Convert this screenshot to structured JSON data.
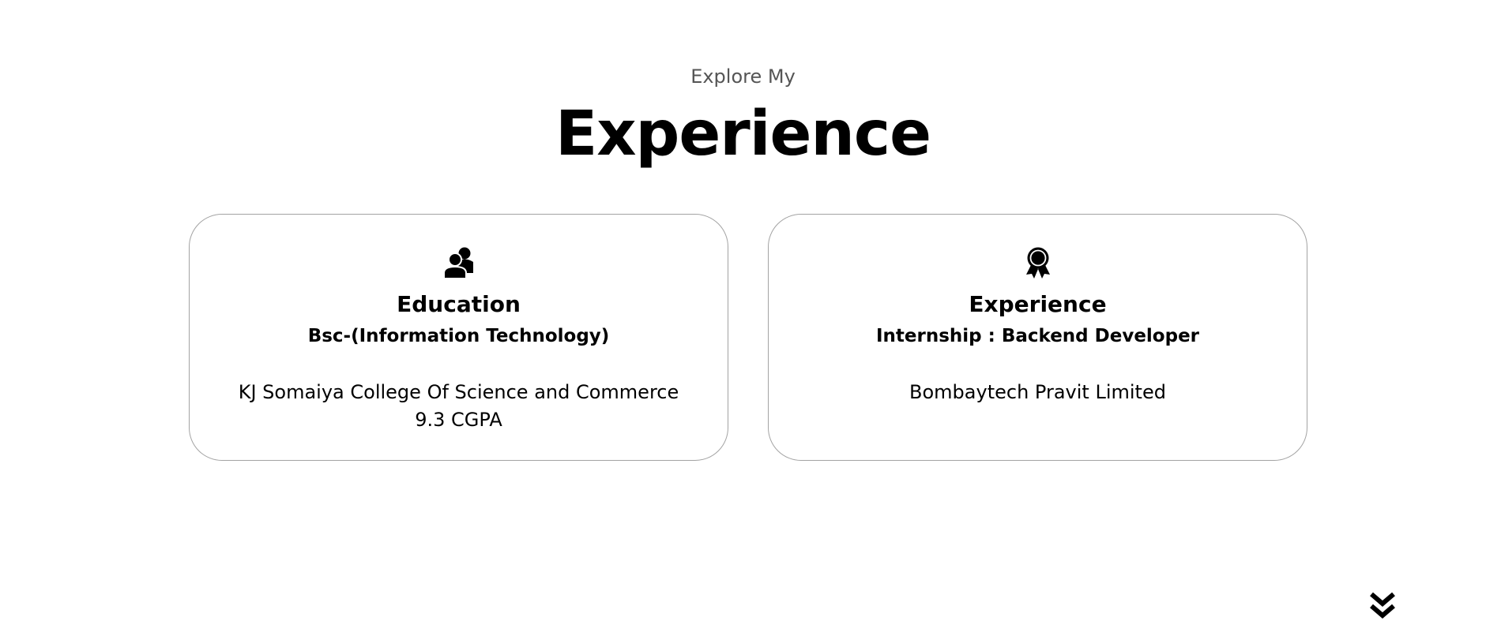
{
  "header": {
    "pre_title": "Explore My",
    "title": "Experience"
  },
  "cards": [
    {
      "icon": "users-icon",
      "heading": "Education",
      "subheading": "Bsc-(Information Technology)",
      "lines": [
        "KJ Somaiya College Of Science and Commerce",
        "9.3 CGPA"
      ]
    },
    {
      "icon": "award-ribbon-icon",
      "heading": "Experience",
      "subheading": "Internship : Backend Developer",
      "lines": [
        "Bombaytech Pravit Limited"
      ]
    }
  ],
  "scroll": {
    "icon": "double-chevron-down-icon"
  },
  "colors": {
    "background": "#ffffff",
    "text": "#000000",
    "pre_title": "#555555",
    "card_border": "#a3a3a3"
  }
}
